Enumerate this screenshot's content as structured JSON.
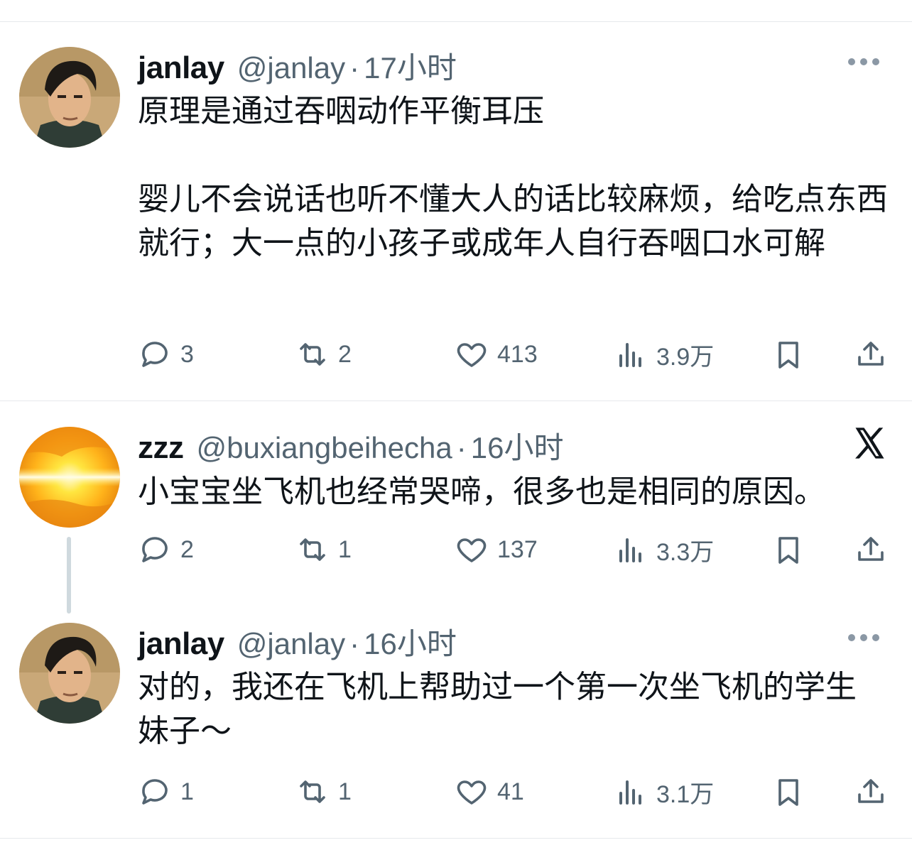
{
  "tweets": [
    {
      "name": "janlay",
      "handle": "@janlay",
      "time": "17小时",
      "text": "原理是通过吞咽动作平衡耳压\n\n婴儿不会说话也听不懂大人的话比较麻烦，给吃点东西就行；大一点的小孩子或成年人自行吞咽口水可解",
      "stats": {
        "replies": "3",
        "retweets": "2",
        "likes": "413",
        "views": "3.9万"
      }
    },
    {
      "name": "zzz",
      "handle": "@buxiangbeihecha",
      "time": "16小时",
      "text": "小宝宝坐飞机也经常哭啼，很多也是相同的原因。",
      "stats": {
        "replies": "2",
        "retweets": "1",
        "likes": "137",
        "views": "3.3万"
      }
    },
    {
      "name": "janlay",
      "handle": "@janlay",
      "time": "16小时",
      "text": "对的，我还在飞机上帮助过一个第一次坐飞机的学生妹子～",
      "stats": {
        "replies": "1",
        "retweets": "1",
        "likes": "41",
        "views": "3.1万"
      }
    }
  ],
  "separator": "·",
  "icons": {
    "reply": "reply-icon",
    "retweet": "retweet-icon",
    "like": "heart-icon",
    "views": "views-icon",
    "bookmark": "bookmark-icon",
    "share": "share-icon",
    "more": "more-icon",
    "x_logo": "x-logo-icon"
  },
  "colors": {
    "text": "#0f1419",
    "secondary": "#536471",
    "divider": "#e6e9ec",
    "thread_line": "#cfd9de"
  }
}
